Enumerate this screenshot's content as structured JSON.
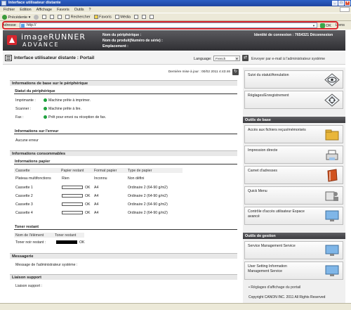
{
  "window": {
    "title": "Interface utilisateur distante"
  },
  "menu": [
    "Fichier",
    "Edition",
    "Affichage",
    "Favoris",
    "Outils",
    "?"
  ],
  "toolbar": {
    "back": "Précédente",
    "search": "Rechercher",
    "favorites": "Favoris",
    "media": "Média"
  },
  "address": {
    "label": "Adresse",
    "value": "http://",
    "go": "OK",
    "links": "Liens"
  },
  "banner": {
    "logo_line1": "imageRUNNER",
    "logo_line2": "ADVANCE",
    "device_name_label": "Nom du périphérique :",
    "product_name_label": "Nom du produit(Numéro de série) :",
    "location_label": "Emplacement :",
    "login": "Identité de connexion : 7654321 Déconnexion"
  },
  "portal": {
    "title": "Interface utilisateur distante : Portail",
    "language_label": "Language:",
    "language_value": "French",
    "send_email": "Envoyer par e-mail à l'administrateur système"
  },
  "main": {
    "last_update": "Dernière mise à jour : 00/02 2011 4:43:46",
    "basic_info": "Informations de base sur le périphérique",
    "device_status": "Statut du périphérique",
    "status_rows": [
      {
        "label": "Imprimante :",
        "value": "Machine prête à imprimer."
      },
      {
        "label": "Scanner :",
        "value": "Machine prête à lire."
      },
      {
        "label": "Fax :",
        "value": "Prêt pour envoi ou réception de fax."
      }
    ],
    "error_info": "Informations sur l'erreur",
    "no_error": "Aucune erreur",
    "consumables": "Informations consommables",
    "paper_info": "Informations papier",
    "paper_headers": [
      "Cassette",
      "Papier restant",
      "Format papier",
      "Type de papier"
    ],
    "paper_rows": [
      {
        "name": "Plateau multifonctions",
        "remaining": "Rien",
        "format": "Inconnu",
        "type": "Non défini",
        "bar": false
      },
      {
        "name": "Cassette 1",
        "remaining": "OK",
        "format": "A4",
        "type": "Ordinaire 2 (64-90 g/m2)",
        "bar": true
      },
      {
        "name": "Cassette 2",
        "remaining": "OK",
        "format": "A4",
        "type": "Ordinaire 2 (64-90 g/m2)",
        "bar": true
      },
      {
        "name": "Cassette 3",
        "remaining": "OK",
        "format": "A4",
        "type": "Ordinaire 2 (64-90 g/m2)",
        "bar": true
      },
      {
        "name": "Cassette 4",
        "remaining": "OK",
        "format": "A4",
        "type": "Ordinaire 2 (64-90 g/m2)",
        "bar": true
      }
    ],
    "toner_title": "Toner restant",
    "toner_headers": [
      "Nom de l'élément",
      "Toner restant"
    ],
    "toner_row": {
      "name": "Toner noir restant :",
      "value": "OK"
    },
    "messaging": "Messagerie",
    "admin_message_label": "Message de l'administrateur système :",
    "support_link": "Liaison support",
    "support_label": "Liaison support :"
  },
  "right": {
    "status_cancel": "Suivi du statut/Annulation",
    "settings": "Réglages/Enregistrement",
    "basic_tools": "Outils de base",
    "access_files": "Accès aux fichiers reçus/mémorisés",
    "direct_print": "Impression directe",
    "address_book": "Carnet d'adresses",
    "quick_menu": "Quick Menu",
    "access_control": "Contrôle d'accès utilisateur Espace avancé",
    "management_tools": "Outils de gestion",
    "service_mgmt": "Service Management Service",
    "user_setting": "User Setting Information Management Service",
    "portal_prefs": "Réglages d'affichage du portail",
    "copyright": "Copyright CANON INC. 2011 All Rights Reserved"
  }
}
